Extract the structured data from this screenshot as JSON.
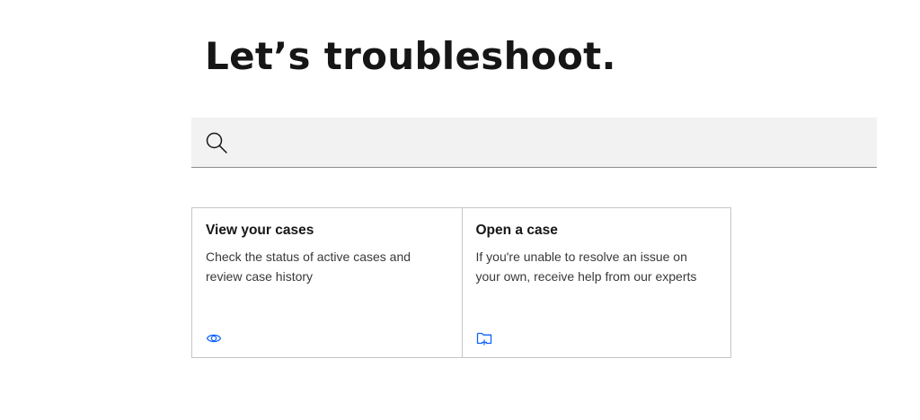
{
  "page": {
    "title": "Let’s troubleshoot."
  },
  "search": {
    "placeholder": "",
    "value": "",
    "icon": "search-icon"
  },
  "cards": [
    {
      "title": "View your cases",
      "description": "Check the status of active cases and review case history",
      "icon": "eye-icon"
    },
    {
      "title": "Open a case",
      "description": "If you're unable to resolve an issue on your own, receive help from our experts",
      "icon": "folder-add-icon"
    }
  ],
  "colors": {
    "accent": "#0f62fe",
    "search_background": "#f2f2f2",
    "border": "#c6c6c6",
    "text": "#161616"
  }
}
